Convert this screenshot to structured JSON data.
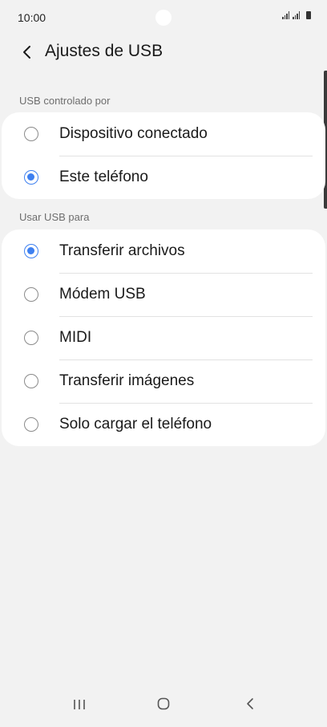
{
  "status_bar": {
    "time": "10:00"
  },
  "header": {
    "title": "Ajustes de USB"
  },
  "sections": [
    {
      "label": "USB controlado por",
      "options": [
        {
          "label": "Dispositivo conectado",
          "selected": false
        },
        {
          "label": "Este teléfono",
          "selected": true
        }
      ]
    },
    {
      "label": "Usar USB para",
      "options": [
        {
          "label": "Transferir archivos",
          "selected": true
        },
        {
          "label": "Módem USB",
          "selected": false
        },
        {
          "label": "MIDI",
          "selected": false
        },
        {
          "label": "Transferir imágenes",
          "selected": false
        },
        {
          "label": "Solo cargar el teléfono",
          "selected": false
        }
      ]
    }
  ],
  "colors": {
    "accent": "#3e80f0",
    "background": "#f2f2f2",
    "card": "#ffffff"
  },
  "icons": {
    "back": "chevron-left-icon",
    "nav_recent": "recent-apps-icon",
    "nav_home": "home-icon",
    "nav_back": "nav-back-icon"
  }
}
